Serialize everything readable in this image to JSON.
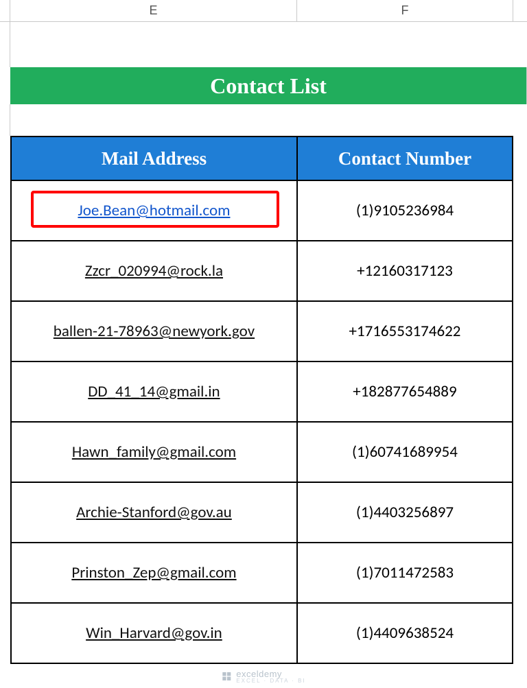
{
  "columns": {
    "E": "E",
    "F": "F"
  },
  "title": "Contact List",
  "headers": {
    "mail": "Mail Address",
    "contact": "Contact Number"
  },
  "rows": [
    {
      "mail": "Joe.Bean@hotmail.com",
      "contact": "(1)9105236984",
      "highlighted": true,
      "link_color": "blue"
    },
    {
      "mail": "Zzcr_020994@rock.la",
      "contact": "+12160317123",
      "highlighted": false,
      "link_color": "black"
    },
    {
      "mail": "ballen-21-78963@newyork.gov",
      "contact": "+1716553174622",
      "highlighted": false,
      "link_color": "black"
    },
    {
      "mail": "DD_41_14@gmail.in",
      "contact": "+182877654889",
      "highlighted": false,
      "link_color": "black"
    },
    {
      "mail": "Hawn_family@gmail.com",
      "contact": "(1)60741689954",
      "highlighted": false,
      "link_color": "black"
    },
    {
      "mail": "Archie-Stanford@gov.au",
      "contact": "(1)4403256897",
      "highlighted": false,
      "link_color": "black"
    },
    {
      "mail": "Prinston_Zep@gmail.com",
      "contact": "(1)7011472583",
      "highlighted": false,
      "link_color": "black"
    },
    {
      "mail": "Win_Harvard@gov.in",
      "contact": "(1)4409638524",
      "highlighted": false,
      "link_color": "black"
    }
  ],
  "watermark": {
    "brand": "exceldemy",
    "tag": "EXCEL · DATA · BI"
  }
}
